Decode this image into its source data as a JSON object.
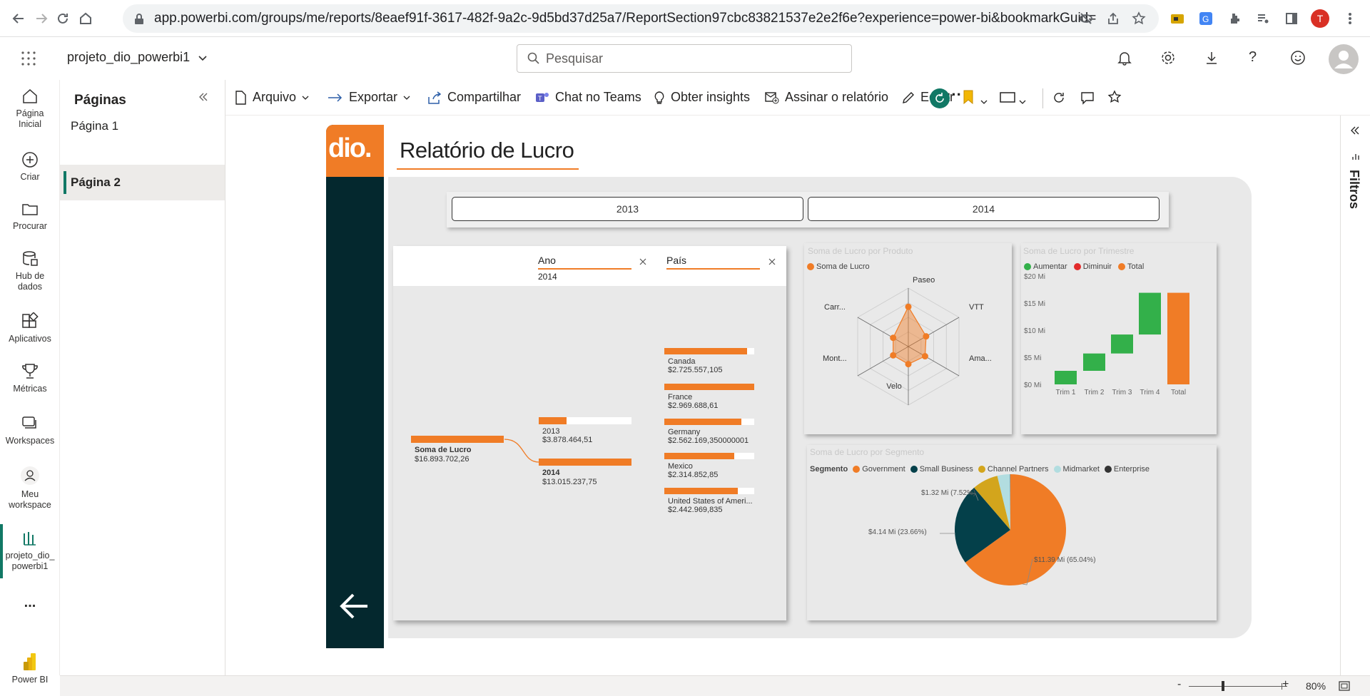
{
  "browser": {
    "url": "app.powerbi.com/groups/me/reports/8eaef91f-3617-482f-9a2c-9d5bd37d25a7/ReportSection97cbc83821537e2e2f6e?experience=power-bi&bookmarkGuid=Book...",
    "profile_initial": "T"
  },
  "header": {
    "workspace_title": "projeto_dio_powerbi1",
    "search_placeholder": "Pesquisar"
  },
  "nav": {
    "items": [
      {
        "label1": "Página",
        "label2": "Inicial"
      },
      {
        "label1": "Criar",
        "label2": ""
      },
      {
        "label1": "Procurar",
        "label2": ""
      },
      {
        "label1": "Hub de",
        "label2": "dados"
      },
      {
        "label1": "Aplicativos",
        "label2": ""
      },
      {
        "label1": "Métricas",
        "label2": ""
      },
      {
        "label1": "Workspaces",
        "label2": ""
      },
      {
        "label1": "Meu",
        "label2": "workspace"
      },
      {
        "label1": "projeto_dio_",
        "label2": "powerbi1"
      }
    ],
    "more": "...",
    "brand": "Power BI"
  },
  "pages_pane": {
    "title": "Páginas",
    "pages": [
      "Página 1",
      "Página 2"
    ],
    "selected_index": 1
  },
  "toolbar": {
    "arquivo": "Arquivo",
    "exportar": "Exportar",
    "compartilhar": "Compartilhar",
    "teams": "Chat no Teams",
    "insights": "Obter insights",
    "assinar": "Assinar o relatório",
    "editar": "Editar",
    "more": "···"
  },
  "filters_label": "Filtros",
  "report": {
    "logo": "dio.",
    "title": "Relatório de Lucro",
    "slicer_years": [
      "2013",
      "2014"
    ],
    "accent": "#f07c26",
    "dark": "#04282e"
  },
  "decomp": {
    "col1_header": "Ano",
    "col1_value": "2014",
    "col2_header": "País",
    "root_label": "Soma de Lucro",
    "root_value": "$16.893.702,26",
    "years": [
      {
        "label": "2013",
        "value": "$3.878.464,51",
        "fill": 0.3
      },
      {
        "label": "2014",
        "value": "$13.015.237,75",
        "fill": 1.0
      }
    ],
    "countries": [
      {
        "label": "Canada",
        "value": "$2.725.557,105",
        "fill": 0.92
      },
      {
        "label": "France",
        "value": "$2.969.688,61",
        "fill": 1.0
      },
      {
        "label": "Germany",
        "value": "$2.562.169,350000001",
        "fill": 0.86
      },
      {
        "label": "Mexico",
        "value": "$2.314.852,85",
        "fill": 0.78
      },
      {
        "label": "United States of Ameri...",
        "value": "$2.442.969,835",
        "fill": 0.82
      }
    ]
  },
  "radar": {
    "title": "Soma de Lucro por Produto",
    "legend": "Soma de Lucro",
    "axes": [
      "Paseo",
      "VTT",
      "Ama...",
      "Velo",
      "Mont...",
      "Carr..."
    ],
    "values": [
      0.68,
      0.35,
      0.33,
      0.3,
      0.3,
      0.3
    ]
  },
  "waterfall": {
    "title": "Soma de Lucro por Trimestre",
    "legend": [
      "Aumentar",
      "Diminuir",
      "Total"
    ],
    "legend_colors": [
      "#33b04a",
      "#e22b2b",
      "#f07c26"
    ],
    "yticks": [
      "$20 Mi",
      "$15 Mi",
      "$10 Mi",
      "$5 Mi",
      "$0 Mi"
    ],
    "categories": [
      "Trim 1",
      "Trim 2",
      "Trim 3",
      "Trim 4",
      "Total"
    ]
  },
  "pie": {
    "title": "Soma de Lucro por Segmento",
    "legend_title": "Segmento",
    "legend": [
      "Government",
      "Small Business",
      "Channel Partners",
      "Midmarket",
      "Enterprise"
    ],
    "colors": [
      "#f07c26",
      "#04404a",
      "#d3a51c",
      "#b2dde0",
      "#333333"
    ],
    "labels": [
      "$1.32 Mi (7.52%)",
      "$4.14 Mi (23.66%)",
      "$11.39 Mi (65.04%)"
    ]
  },
  "chart_data": [
    {
      "type": "radar",
      "title": "Soma de Lucro por Produto",
      "categories": [
        "Paseo",
        "VTT",
        "Ama...",
        "Velo",
        "Mont...",
        "Carr..."
      ],
      "series": [
        {
          "name": "Soma de Lucro",
          "values": [
            0.68,
            0.35,
            0.33,
            0.3,
            0.3,
            0.3
          ]
        }
      ]
    },
    {
      "type": "bar",
      "subtype": "waterfall",
      "title": "Soma de Lucro por Trimestre",
      "categories": [
        "Trim 1",
        "Trim 2",
        "Trim 3",
        "Trim 4",
        "Total"
      ],
      "values": [
        2.5,
        3.2,
        3.5,
        7.7,
        16.9
      ],
      "ylim": [
        0,
        20
      ],
      "yticks": [
        "$0 Mi",
        "$5 Mi",
        "$10 Mi",
        "$15 Mi",
        "$20 Mi"
      ]
    },
    {
      "type": "pie",
      "title": "Soma de Lucro por Segmento",
      "categories": [
        "Government",
        "Small Business",
        "Channel Partners",
        "Midmarket",
        "Enterprise"
      ],
      "values": [
        65.04,
        23.66,
        7.52,
        3.7,
        0.08
      ]
    }
  ],
  "zoom": {
    "minus": "-",
    "plus": "+",
    "level": "80%"
  }
}
